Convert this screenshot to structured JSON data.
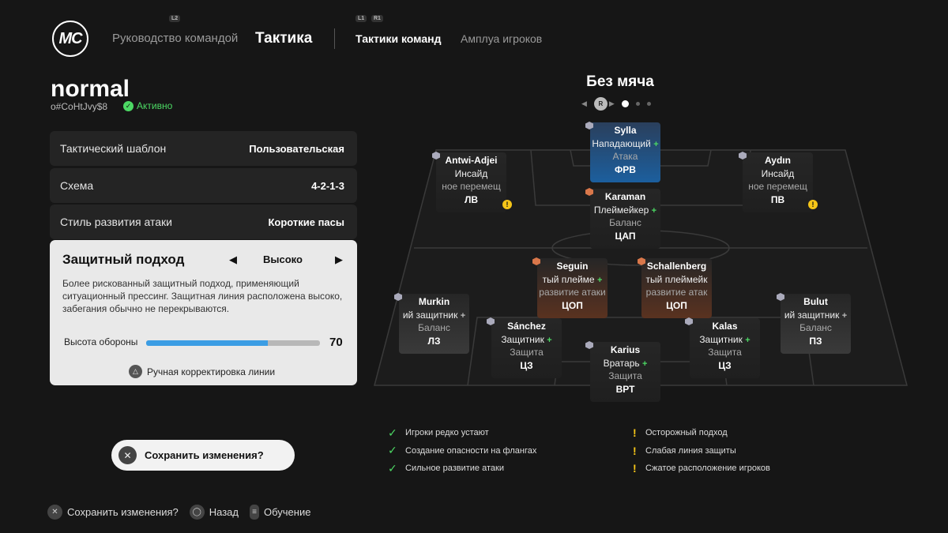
{
  "header": {
    "logo_text": "MC",
    "hint_left": "L2",
    "hint_mid_1": "L1",
    "hint_mid_2": "R1",
    "nav": [
      {
        "label": "Руководство командой"
      },
      {
        "label": "Тактика"
      },
      {
        "label": "Тактики команд"
      },
      {
        "label": "Амплуа игроков"
      }
    ]
  },
  "tactic": {
    "name": "normal",
    "code": "o#CoHtJvy$8",
    "status": "Активно"
  },
  "settings": [
    {
      "label": "Тактический шаблон",
      "value": "Пользовательская"
    },
    {
      "label": "Схема",
      "value": "4-2-1-3"
    },
    {
      "label": "Стиль развития атаки",
      "value": "Короткие пасы"
    }
  ],
  "defense_card": {
    "title": "Защитный подход",
    "value": "Высоко",
    "description": "Более рискованный защитный подход, применяющий ситуационный прессинг. Защитная линия расположена высоко, забегания обычно не перекрываются.",
    "slider_label": "Высота обороны",
    "slider_value": "70",
    "slider_fraction": 0.7,
    "manual_adjust": "Ручная корректировка линии"
  },
  "save_pill": {
    "label": "Сохранить изменения?"
  },
  "footer": [
    {
      "label": "Сохранить изменения?"
    },
    {
      "label": "Назад"
    },
    {
      "label": "Обучение"
    }
  ],
  "pitch": {
    "title": "Без мяча",
    "page_button": "R"
  },
  "players": [
    {
      "name": "Sylla",
      "role": "Нападающий",
      "style": "Атака",
      "pos": "ФРВ",
      "plus": true
    },
    {
      "name": "Antwi-Adjei",
      "role": "Инсайд",
      "style": "ное перемещ",
      "pos": "ЛВ",
      "warn": true
    },
    {
      "name": "Aydın",
      "role": "Инсайд",
      "style": "ное перемещ",
      "pos": "ПВ",
      "warn": true
    },
    {
      "name": "Karaman",
      "role": "Плеймейкер",
      "style": "Баланс",
      "pos": "ЦАП",
      "plus": true
    },
    {
      "name": "Seguin",
      "role": "тый плейме",
      "style": "развитие атаки",
      "pos": "ЦОП",
      "plus": true
    },
    {
      "name": "Schallenberg",
      "role": "тый плеймейк",
      "style": "развитие атак",
      "pos": "ЦОП"
    },
    {
      "name": "Murkin",
      "role": "ий защитник",
      "style": "Баланс",
      "pos": "ЛЗ",
      "plus": true
    },
    {
      "name": "Bulut",
      "role": "ий защитник",
      "style": "Баланс",
      "pos": "ПЗ",
      "plus": true
    },
    {
      "name": "Sánchez",
      "role": "Защитник",
      "style": "Защита",
      "pos": "ЦЗ",
      "plus": true
    },
    {
      "name": "Kalas",
      "role": "Защитник",
      "style": "Защита",
      "pos": "ЦЗ",
      "plus": true
    },
    {
      "name": "Karius",
      "role": "Вратарь",
      "style": "Защита",
      "pos": "ВРТ",
      "plus": true
    }
  ],
  "summary_good": [
    "Игроки редко устают",
    "Создание опасности на флангах",
    "Сильное развитие атаки"
  ],
  "summary_warn": [
    "Осторожный подход",
    "Слабая линия защиты",
    "Сжатое расположение игроков"
  ],
  "colors": {
    "background": "#161616",
    "accent_blue": "#3b9de4",
    "positive": "#4cd964",
    "warning": "#f5c518",
    "forward_card": "#1c5f9e",
    "cdm_card": "#5a3220"
  }
}
